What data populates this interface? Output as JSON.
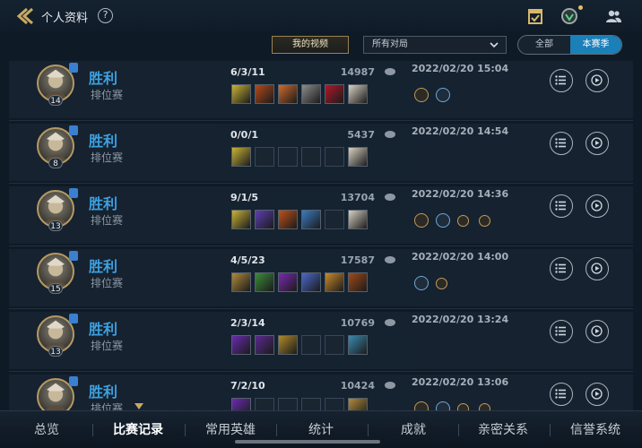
{
  "header": {
    "title": "个人资料",
    "help": "?"
  },
  "filters": {
    "video_label": "我的视频",
    "mode_select": "所有对局",
    "segment": [
      "全部",
      "本赛季"
    ],
    "segment_active": "本赛季"
  },
  "matches": [
    {
      "result": "胜利",
      "mode": "排位赛",
      "level": "14",
      "kda": "6/3/11",
      "gold": "14987",
      "time": "2022/02/20 15:04",
      "items": [
        "#c9b335",
        "#b24a1a",
        "#d06a2a",
        "#8c8c8c",
        "#b0182a",
        "#d8d1c3"
      ],
      "badges": [
        "gold-s",
        "blue"
      ]
    },
    {
      "result": "胜利",
      "mode": "排位赛",
      "level": "8",
      "kda": "0/0/1",
      "gold": "5437",
      "time": "2022/02/20 14:54",
      "items": [
        "#c9b335",
        "",
        "",
        "",
        "",
        "#d8d1c3"
      ],
      "badges": []
    },
    {
      "result": "胜利",
      "mode": "排位赛",
      "level": "13",
      "kda": "9/1/5",
      "gold": "13704",
      "time": "2022/02/20 14:36",
      "items": [
        "#c9b335",
        "#5c3fb0",
        "#c0501a",
        "#3a7cc0",
        "",
        "#d8d1c3"
      ],
      "badges": [
        "gold-s",
        "blue",
        "bronze",
        "bronze"
      ]
    },
    {
      "result": "胜利",
      "mode": "排位赛",
      "level": "15",
      "kda": "4/5/23",
      "gold": "17587",
      "time": "2022/02/20 14:00",
      "items": [
        "#b08a3a",
        "#3c8a3a",
        "#7a2ab0",
        "#4a68c8",
        "#c98a2a",
        "#a04a1a"
      ],
      "badges": [
        "blue",
        "bronze"
      ]
    },
    {
      "result": "胜利",
      "mode": "排位赛",
      "level": "13",
      "kda": "2/3/14",
      "gold": "10769",
      "time": "2022/02/20 13:24",
      "items": [
        "#6a2ab0",
        "#5a2a90",
        "#b08a2a",
        "",
        "",
        "#3a8ab0"
      ],
      "badges": []
    },
    {
      "result": "胜利",
      "mode": "排位赛",
      "level": "",
      "kda": "7/2/10",
      "gold": "10424",
      "time": "2022/02/20 13:06",
      "items": [
        "#6a2ab0",
        "",
        "",
        "",
        "",
        "#b08a3a"
      ],
      "badges": [
        "gold-s",
        "blue",
        "bronze",
        "bronze"
      ]
    }
  ],
  "nav": {
    "tabs": [
      "总览",
      "比赛记录",
      "常用英雄",
      "统计",
      "成就",
      "亲密关系",
      "信誉系统"
    ],
    "active": "比赛记录"
  },
  "colors": {
    "win_blue": "#3ca0e0",
    "accent_gold": "#b59a63",
    "segment_active_bg": "#1b7fb8"
  },
  "icons": [
    "back-arrow-icon",
    "help-icon",
    "calendar-check-icon",
    "profile-emblem-icon",
    "friends-icon",
    "chevron-down-icon",
    "gold-coin-icon",
    "list-icon",
    "play-icon"
  ]
}
